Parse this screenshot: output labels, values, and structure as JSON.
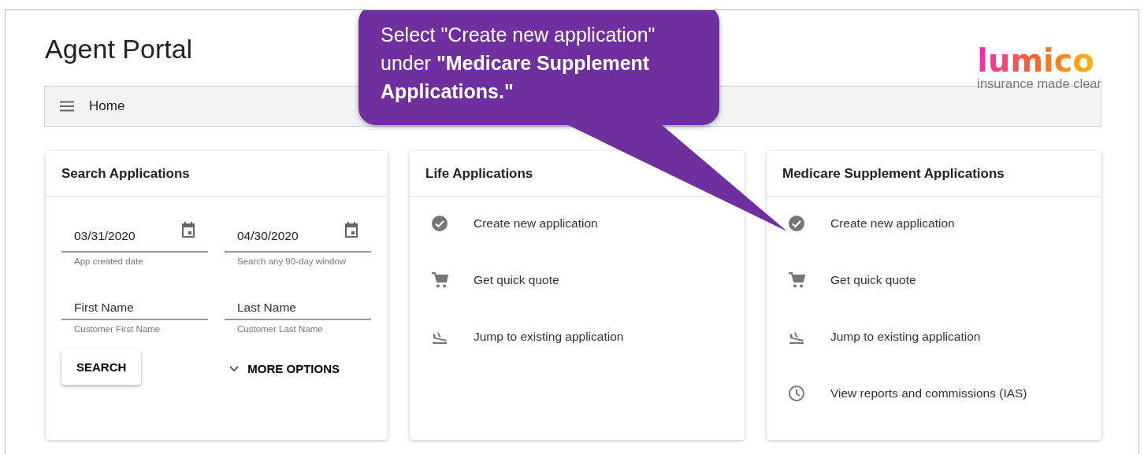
{
  "header": {
    "title": "Agent Portal",
    "logo": {
      "name": "lumico",
      "tagline": "insurance made clear"
    }
  },
  "nav": {
    "label": "Home"
  },
  "search_card": {
    "title": "Search Applications",
    "fields": [
      {
        "value": "03/31/2020",
        "hint": "App created date",
        "kind": "date"
      },
      {
        "value": "04/30/2020",
        "hint": "Search any 90-day window",
        "kind": "date"
      },
      {
        "placeholder": "First Name",
        "hint": "Customer First Name",
        "kind": "text"
      },
      {
        "placeholder": "Last Name",
        "hint": "Customer Last Name",
        "kind": "text"
      }
    ],
    "search_button": "SEARCH",
    "more_options": "MORE OPTIONS"
  },
  "cards": [
    {
      "title": "Life Applications",
      "items": [
        {
          "label": "Create new application",
          "kind": "check"
        },
        {
          "label": "Get quick quote",
          "kind": "cart"
        },
        {
          "label": "Jump to existing application",
          "kind": "landing"
        }
      ]
    },
    {
      "title": "Medicare Supplement Applications",
      "items": [
        {
          "label": "Create new application",
          "kind": "check"
        },
        {
          "label": "Get quick quote",
          "kind": "cart"
        },
        {
          "label": "Jump to existing application",
          "kind": "landing"
        },
        {
          "label": "View reports and commissions (IAS)",
          "kind": "clock"
        }
      ]
    }
  ],
  "callout": {
    "text": "Select \"Create new application\" under **\"Medicare Supplement Applications.\"**"
  }
}
